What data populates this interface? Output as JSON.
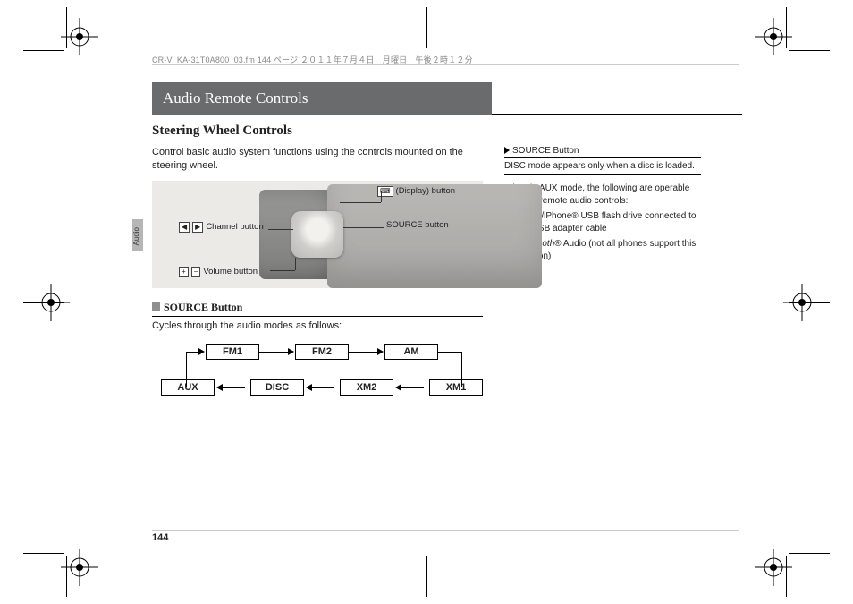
{
  "meta_header": "CR-V_KA-31T0A800_03.fm  144 ページ  ２０１１年７月４日　月曜日　午後２時１２分",
  "side_tab_label": "Audio",
  "page_number": "144",
  "title": "Audio Remote Controls",
  "subtitle": "Steering Wheel Controls",
  "intro": "Control basic audio system functions using the controls mounted on the steering wheel.",
  "callouts": {
    "display": "(Display) button",
    "channel": "Channel button",
    "volume": "Volume button",
    "source": "SOURCE button",
    "channel_icons": "◀ ▶",
    "volume_icons": "＋ −",
    "display_icon": "⌨"
  },
  "source_section": {
    "heading": "SOURCE Button",
    "desc": "Cycles through the audio modes as follows:"
  },
  "flow": {
    "fm1": "FM1",
    "fm2": "FM2",
    "am": "AM",
    "xm1": "XM1",
    "xm2": "XM2",
    "disc": "DISC",
    "aux": "AUX"
  },
  "right": {
    "heading": "SOURCE Button",
    "line1": "DISC mode appears only when a disc is loaded.",
    "lead": "When in AUX mode, the following are operable from the remote audio controls:",
    "b1a": "iPod®/iPhone® USB flash drive connected to the USB adapter cable",
    "b2a": "Bluetooth",
    "b2b": "® Audio (not all phones support this function)"
  }
}
